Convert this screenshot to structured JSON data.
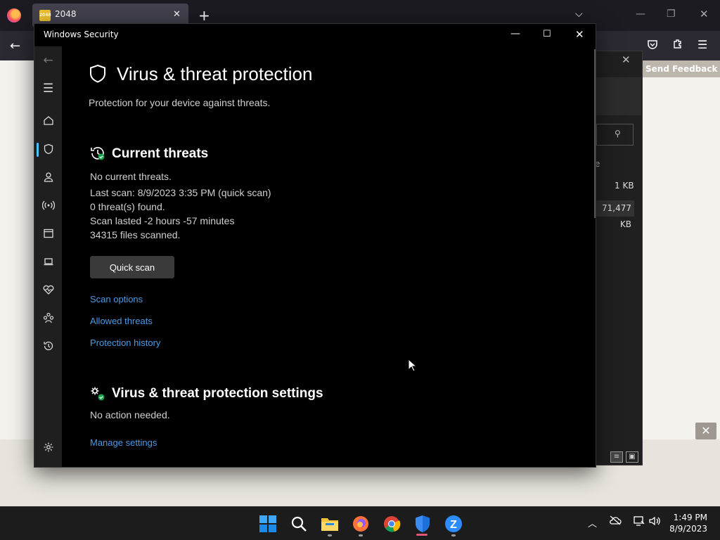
{
  "browser": {
    "tab_title": "2048",
    "tab_favicon_text": "2048",
    "feedback_label": "Send Feedback"
  },
  "background_window": {
    "column_fragment": "e",
    "size_1": "1 KB",
    "size_2": "71,477 KB"
  },
  "security_window": {
    "title": "Windows Security",
    "page_title": "Virus & threat protection",
    "page_subtitle": "Protection for your device against threats.",
    "current_threats": {
      "title": "Current threats",
      "status": "No current threats.",
      "last_scan": "Last scan: 8/9/2023 3:35 PM (quick scan)",
      "threats_found": "0 threat(s) found.",
      "scan_duration": "Scan lasted -2 hours -57 minutes",
      "files_scanned": "34315 files scanned.",
      "quick_scan_button": "Quick scan",
      "links": [
        "Scan options",
        "Allowed threats",
        "Protection history"
      ]
    },
    "settings": {
      "title": "Virus & threat protection settings",
      "status": "No action needed.",
      "manage_link": "Manage settings"
    },
    "nav_items": [
      "back-icon",
      "menu-icon",
      "home-icon",
      "shield-icon",
      "account-icon",
      "network-icon",
      "app-browser-icon",
      "device-security-icon",
      "health-icon",
      "family-icon",
      "history-icon",
      "settings-icon"
    ]
  },
  "taskbar": {
    "time": "1:49 PM",
    "date": "8/9/2023",
    "apps": [
      "start",
      "search",
      "file-explorer",
      "firefox",
      "chrome",
      "windows-security",
      "zoom"
    ]
  },
  "colors": {
    "accent_blue": "#4cc2ff",
    "link_blue": "#4c9be6",
    "window_bg": "#000000",
    "nav_bg": "#1f1f1f"
  }
}
